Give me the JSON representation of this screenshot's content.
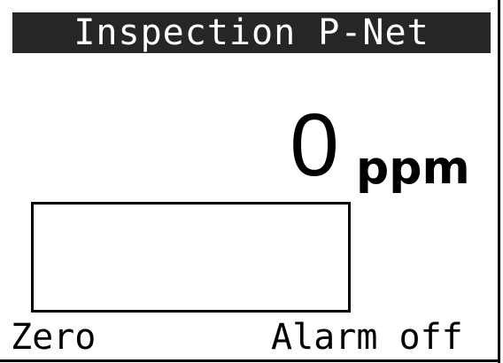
{
  "title": "Inspection P-Net",
  "reading": {
    "value": "0",
    "unit": "ppm",
    "level_fraction": 0
  },
  "softkeys": {
    "left_label": "Zero",
    "right_label": "Alarm off"
  },
  "colors": {
    "title_bar_bg": "#262626",
    "title_text": "#ffffff",
    "foreground": "#000000",
    "background": "#ffffff"
  }
}
